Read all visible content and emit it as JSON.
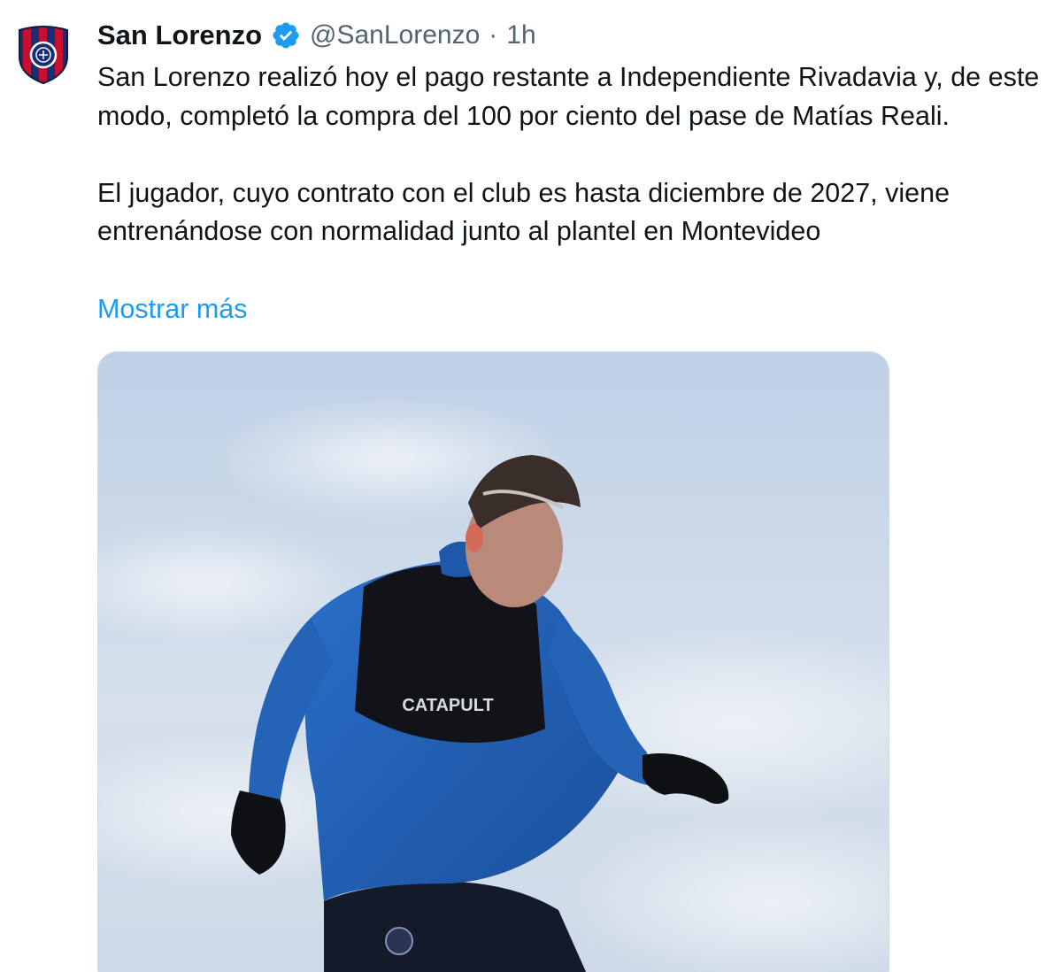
{
  "tweet": {
    "author_name": "San Lorenzo",
    "handle": "@SanLorenzo",
    "separator": "·",
    "time": "1h",
    "paragraph1": "San Lorenzo realizó hoy el pago restante a Independiente Rivadavia y, de este modo, completó la compra del 100 por ciento del pase de Matías Reali.",
    "paragraph2": "El jugador, cuyo contrato con el club es hasta diciembre de 2027, viene entrenándose con normalidad junto al plantel en Montevideo",
    "show_more": "Mostrar más",
    "verified_icon": "verified-badge-icon",
    "colors": {
      "link": "#1d9bf0",
      "secondary_text": "#536471",
      "club_red": "#c8102e",
      "club_blue": "#1a2f73"
    },
    "media": {
      "bib_text": "CATAPULT"
    }
  }
}
